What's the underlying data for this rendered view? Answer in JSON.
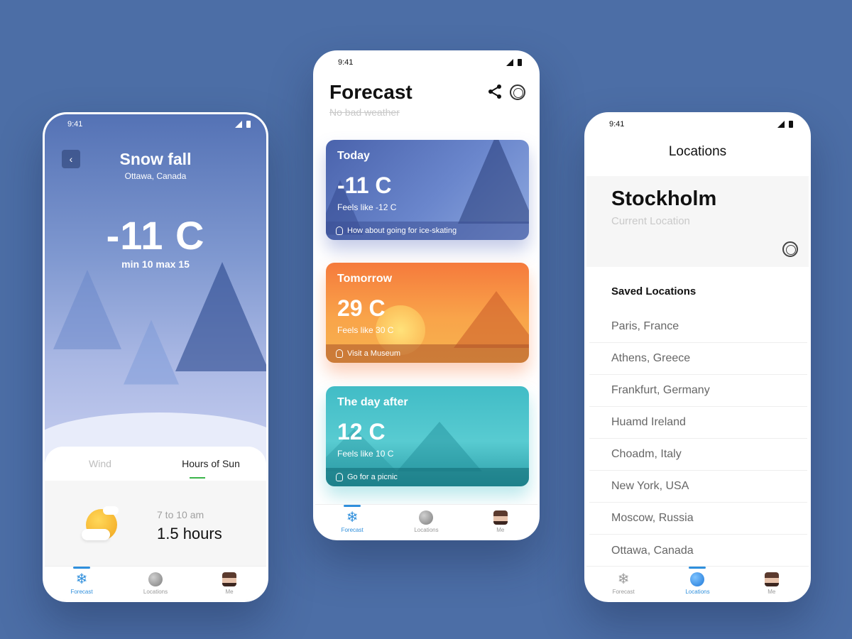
{
  "status_time": "9:41",
  "snowfall": {
    "title": "Snow fall",
    "location": "Ottawa, Canada",
    "temperature": "-11 C",
    "minmax": "min 10  max 15",
    "tabs": [
      "Wind",
      "Hours of Sun"
    ],
    "active_tab": "Hours of Sun",
    "sun_range": "7 to 10 am",
    "sun_hours": "1.5 hours"
  },
  "forecast": {
    "title": "Forecast",
    "subtitle": "No bad weather",
    "cards": [
      {
        "label": "Today",
        "temp": "-11 C",
        "feels": "Feels like -12 C",
        "tip": "How about going for ice-skating"
      },
      {
        "label": "Tomorrow",
        "temp": "29 C",
        "feels": "Feels like 30 C",
        "tip": "Visit a Museum"
      },
      {
        "label": "The day after",
        "temp": "12 C",
        "feels": "Feels like 10 C",
        "tip": "Go for a picnic"
      }
    ]
  },
  "locations": {
    "title": "Locations",
    "current_city": "Stockholm",
    "current_label": "Current Location",
    "saved_title": "Saved Locations",
    "saved": [
      "Paris, France",
      "Athens, Greece",
      "Frankfurt, Germany",
      "Huamd Ireland",
      "Choadm, Italy",
      "New York, USA",
      "Moscow, Russia",
      "Ottawa, Canada"
    ]
  },
  "nav": {
    "forecast": "Forecast",
    "locations": "Locations",
    "me": "Me"
  },
  "colors": {
    "background": "#4c6ea6",
    "accent": "#2f8fdc",
    "tab_underline": "#3ab44a"
  },
  "icons": {
    "back": "chevron-left-icon",
    "share": "share-icon",
    "help": "lifebuoy-icon",
    "tip": "lightbulb-icon",
    "forecast_nav": "snowflake-icon",
    "locations_nav": "globe-icon",
    "me_nav": "avatar-icon",
    "sun": "sun-cloud-icon"
  }
}
